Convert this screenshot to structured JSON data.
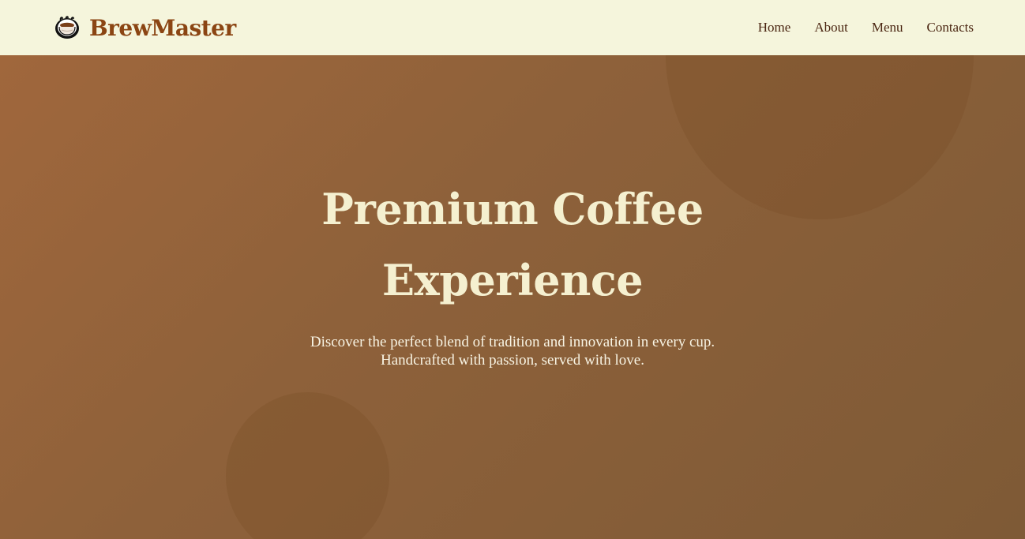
{
  "header": {
    "brand_name": "BrewMaster",
    "brand_icon": "coffee-cup-icon",
    "nav": [
      {
        "label": "Home"
      },
      {
        "label": "About"
      },
      {
        "label": "Menu"
      },
      {
        "label": "Contacts"
      }
    ]
  },
  "hero": {
    "title": "Premium Coffee Experience",
    "subtitle": "Discover the perfect blend of tradition and innovation in every cup. Handcrafted with passion, served with love."
  },
  "colors": {
    "header_bg": "#f5f5dc",
    "brand": "#8b4513",
    "nav_text": "#4a2511",
    "hero_bg": "#8e613a",
    "hero_text": "#f5f0d0"
  }
}
